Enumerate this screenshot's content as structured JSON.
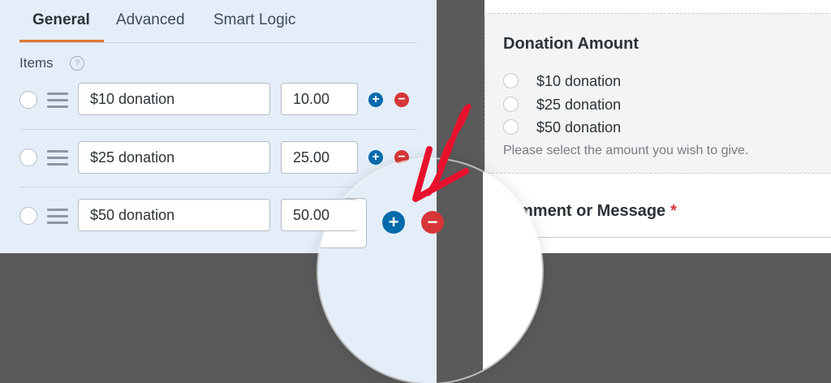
{
  "tabs": [
    {
      "label": "General",
      "active": true
    },
    {
      "label": "Advanced",
      "active": false
    },
    {
      "label": "Smart Logic",
      "active": false
    }
  ],
  "items_label": "Items",
  "help_icon_glyph": "?",
  "items": [
    {
      "label": "$10 donation",
      "value": "10.00"
    },
    {
      "label": "$25 donation",
      "value": "25.00"
    },
    {
      "label": "$50 donation",
      "value": "50.00"
    }
  ],
  "add_glyph": "+",
  "remove_glyph": "−",
  "preview": {
    "field_title": "Donation Amount",
    "options": [
      "$10 donation",
      "$25 donation",
      "$50 donation"
    ],
    "description": "Please select the amount you wish to give.",
    "second_field_title": "mment or Message",
    "required_mark": "*"
  },
  "colors": {
    "accent_tab": "#e27730",
    "add": "#036aab",
    "remove": "#d63638",
    "annotation_arrow": "#e8112d"
  },
  "icons": {
    "help": "question-circle-icon",
    "drag": "drag-handle-icon",
    "add": "plus-circle-icon",
    "remove": "minus-circle-icon"
  }
}
